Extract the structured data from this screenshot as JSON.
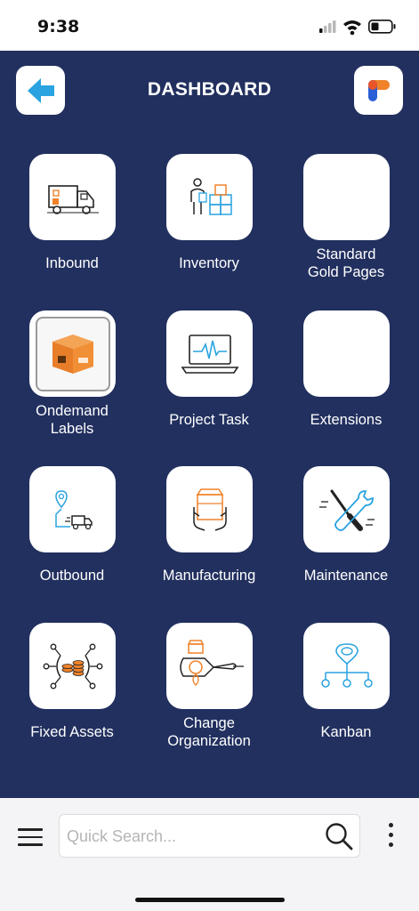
{
  "status_bar": {
    "time": "9:38"
  },
  "header": {
    "title": "DASHBOARD"
  },
  "tiles": [
    {
      "label": "Inbound",
      "icon": "truck-icon"
    },
    {
      "label": "Inventory",
      "icon": "warehouse-worker-icon"
    },
    {
      "label": "Standard\nGold Pages",
      "icon": ""
    },
    {
      "label": "Ondemand\nLabels",
      "icon": "package-icon"
    },
    {
      "label": "Project Task",
      "icon": "laptop-pulse-icon"
    },
    {
      "label": "Extensions",
      "icon": ""
    },
    {
      "label": "Outbound",
      "icon": "delivery-route-icon"
    },
    {
      "label": "Manufacturing",
      "icon": "box-hands-icon"
    },
    {
      "label": "Maintenance",
      "icon": "tools-icon"
    },
    {
      "label": "Fixed Assets",
      "icon": "coins-network-icon"
    },
    {
      "label": "Change\nOrganization",
      "icon": "change-org-icon"
    },
    {
      "label": "Kanban",
      "icon": "kanban-pin-icon"
    }
  ],
  "bottom_bar": {
    "search_placeholder": "Quick Search..."
  },
  "colors": {
    "background": "#22305f",
    "accent_blue": "#2aa3e0",
    "accent_orange": "#f0822a"
  }
}
